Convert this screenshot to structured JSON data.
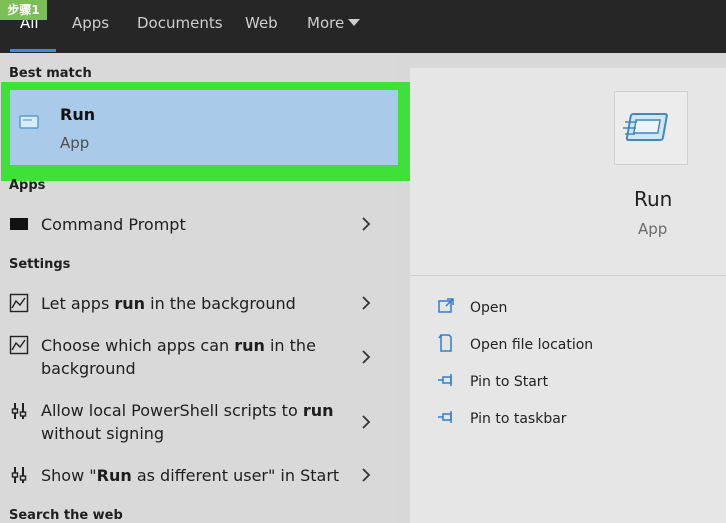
{
  "badge": "步骤1",
  "tabs": [
    {
      "label": "All"
    },
    {
      "label": "Apps"
    },
    {
      "label": "Documents"
    },
    {
      "label": "Web"
    },
    {
      "label": "More"
    }
  ],
  "sections": {
    "best_match": "Best match",
    "apps": "Apps",
    "settings": "Settings",
    "search_web": "Search the web"
  },
  "best_match": {
    "title": "Run",
    "subtitle": "App"
  },
  "apps_items": [
    {
      "label": "Command Prompt"
    }
  ],
  "settings_items": [
    {
      "pre": "Let apps ",
      "bold": "run",
      "post": " in the background"
    },
    {
      "pre": "Choose which apps can ",
      "bold": "run",
      "post": " in the background"
    },
    {
      "pre": "Allow local PowerShell scripts to ",
      "bold": "run",
      "post": " without signing"
    },
    {
      "pre": "Show \"",
      "bold": "Run",
      "post": " as different user\" in Start"
    }
  ],
  "detail": {
    "title": "Run",
    "subtitle": "App"
  },
  "actions": [
    {
      "label": "Open",
      "icon": "open-icon"
    },
    {
      "label": "Open file location",
      "icon": "file-location-icon"
    },
    {
      "label": "Pin to Start",
      "icon": "pin-icon"
    },
    {
      "label": "Pin to taskbar",
      "icon": "pin-icon"
    }
  ],
  "colors": {
    "highlight": "#3ee13a",
    "selected": "#a9cbe9",
    "accent": "#3a8ddb"
  }
}
